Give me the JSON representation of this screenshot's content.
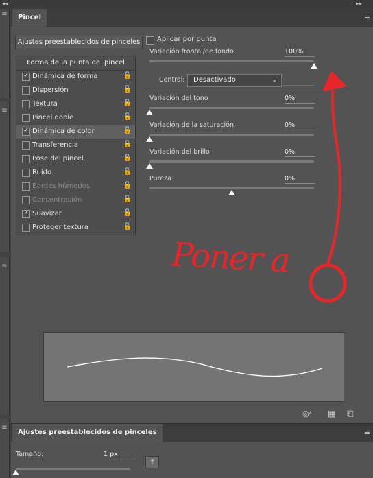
{
  "window": {
    "collapse_left": "◂◂",
    "collapse_right": "▸▸",
    "close_left": "✕",
    "close_right": "✕"
  },
  "brush_panel": {
    "tab_label": "Pincel",
    "menu_icon": "≡",
    "presets_button": "Ajustes preestablecidos de pinceles",
    "section_header": "Forma de la punta del pincel",
    "items": [
      {
        "label": "Dinámica de forma",
        "checked": true,
        "enabled": true,
        "selected": false
      },
      {
        "label": "Dispersión",
        "checked": false,
        "enabled": true,
        "selected": false
      },
      {
        "label": "Textura",
        "checked": false,
        "enabled": true,
        "selected": false
      },
      {
        "label": "Pincel doble",
        "checked": false,
        "enabled": true,
        "selected": false
      },
      {
        "label": "Dinámica de color",
        "checked": true,
        "enabled": true,
        "selected": true
      },
      {
        "label": "Transferencia",
        "checked": false,
        "enabled": true,
        "selected": false
      },
      {
        "label": "Pose del pincel",
        "checked": false,
        "enabled": true,
        "selected": false
      },
      {
        "label": "Ruido",
        "checked": false,
        "enabled": true,
        "selected": false
      },
      {
        "label": "Bordes húmedos",
        "checked": false,
        "enabled": false,
        "selected": false
      },
      {
        "label": "Concentración",
        "checked": false,
        "enabled": false,
        "selected": false
      },
      {
        "label": "Suavizar",
        "checked": true,
        "enabled": true,
        "selected": false
      },
      {
        "label": "Proteger textura",
        "checked": false,
        "enabled": true,
        "selected": false
      }
    ],
    "lock_icon": "🔓",
    "apply_per_tip": {
      "label": "Aplicar por punta",
      "checked": false
    },
    "sliders": [
      {
        "label": "Variación frontal/de fondo",
        "value": "100%",
        "level": 1.0
      },
      {
        "label": "Variación del tono",
        "value": "0%",
        "level": 0.0
      },
      {
        "label": "Variación de la saturación",
        "value": "0%",
        "level": 0.0
      },
      {
        "label": "Variación del brillo",
        "value": "0%",
        "level": 0.0
      },
      {
        "label": "Pureza",
        "value": "0%",
        "level": 0.5
      }
    ],
    "control": {
      "label": "Control:",
      "value": "Desactivado"
    },
    "footer_icons": [
      "eye-brush-icon",
      "grid-icon",
      "new-brush-icon"
    ],
    "footer_glyphs": [
      "◎⁄",
      "▦",
      "⎗"
    ]
  },
  "presets_panel": {
    "tab_label": "Ajustes preestablecidos de pinceles",
    "menu_icon": "≡",
    "size_label": "Tamaño:",
    "size_value": "1 px",
    "size_level": 0.0,
    "pin_icon": "⤒"
  },
  "annotation": {
    "text": "Poner a",
    "color": "#e8262a"
  }
}
